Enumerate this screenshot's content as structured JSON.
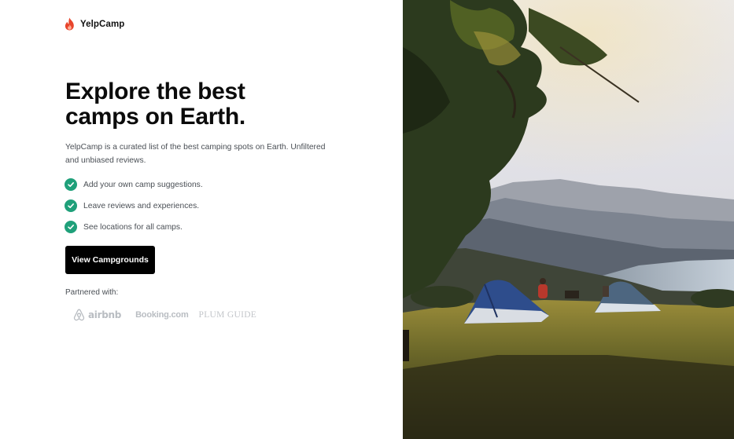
{
  "brand": {
    "name": "YelpCamp",
    "icon": "flame-icon",
    "icon_color": "#e8452c"
  },
  "hero": {
    "headline": "Explore the best camps on Earth.",
    "description": "YelpCamp is a curated list of the best camping spots on Earth. Unfiltered and unbiased reviews."
  },
  "features": [
    {
      "icon": "check-circle-icon",
      "label": "Add your own camp suggestions."
    },
    {
      "icon": "check-circle-icon",
      "label": "Leave reviews and experiences."
    },
    {
      "icon": "check-circle-icon",
      "label": "See locations for all camps."
    }
  ],
  "cta": {
    "label": "View Campgrounds"
  },
  "partners": {
    "label": "Partnered with:",
    "logos": [
      {
        "name": "airbnb",
        "icon": "airbnb-logo-icon"
      },
      {
        "name": "Booking.com"
      },
      {
        "name": "PLUM GUIDE"
      }
    ]
  },
  "colors": {
    "accent_check": "#1fa07a",
    "button_bg": "#000000",
    "button_text": "#ffffff",
    "body_text": "#4a4f55",
    "logo_gray": "#b9bdc2"
  },
  "photo": {
    "subject": "camping-tents-mountain-lake-photo"
  }
}
